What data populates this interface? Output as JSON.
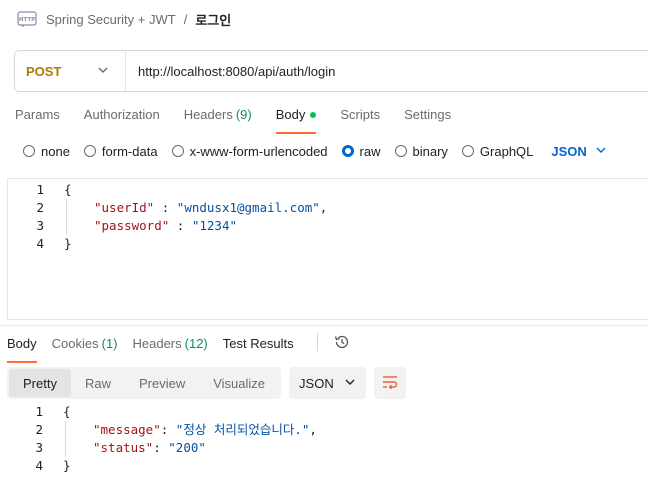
{
  "breadcrumb": {
    "icon": "http-icon",
    "parent": "Spring Security + JWT",
    "separator": "/",
    "current": "로그인"
  },
  "request": {
    "method": "POST",
    "url": "http://localhost:8080/api/auth/login"
  },
  "request_tabs": [
    {
      "label": "Params"
    },
    {
      "label": "Authorization"
    },
    {
      "label": "Headers",
      "count": "(9)"
    },
    {
      "label": "Body",
      "active": true,
      "indicator": "green-dot"
    },
    {
      "label": "Scripts"
    },
    {
      "label": "Settings"
    }
  ],
  "body_types": {
    "options": [
      "none",
      "form-data",
      "x-www-form-urlencoded",
      "raw",
      "binary",
      "GraphQL"
    ],
    "selected": "raw",
    "language": "JSON"
  },
  "request_body": {
    "line_numbers": [
      "1",
      "2",
      "3",
      "4"
    ],
    "open_brace": "{",
    "close_brace": "}",
    "fields": [
      {
        "key": "\"userId\"",
        "sep": " : ",
        "value": "\"wndusx1@gmail.com\"",
        "trail": ","
      },
      {
        "key": "\"password\"",
        "sep": " : ",
        "value": "\"1234\"",
        "trail": ""
      }
    ]
  },
  "response_tabs": [
    {
      "label": "Body",
      "active": true
    },
    {
      "label": "Cookies",
      "count": "(1)"
    },
    {
      "label": "Headers",
      "count": "(12)"
    },
    {
      "label": "Test Results"
    }
  ],
  "response_toolbar": {
    "views": [
      "Pretty",
      "Raw",
      "Preview",
      "Visualize"
    ],
    "active_view": "Pretty",
    "format": "JSON"
  },
  "response_body": {
    "line_numbers": [
      "1",
      "2",
      "3",
      "4"
    ],
    "open_brace": "{",
    "close_brace": "}",
    "fields": [
      {
        "key": "\"message\"",
        "sep": ": ",
        "value": "\"정상 처리되었습니다.\"",
        "trail": ","
      },
      {
        "key": "\"status\"",
        "sep": ": ",
        "value": "\"200\"",
        "trail": ""
      }
    ]
  },
  "colors": {
    "method": "#ad7a03",
    "accent_tab": "#ff6c37",
    "count_green": "#0a8f5b",
    "selected_radio": "#0265d2",
    "json_key": "#a31515",
    "json_string": "#0451a5"
  }
}
